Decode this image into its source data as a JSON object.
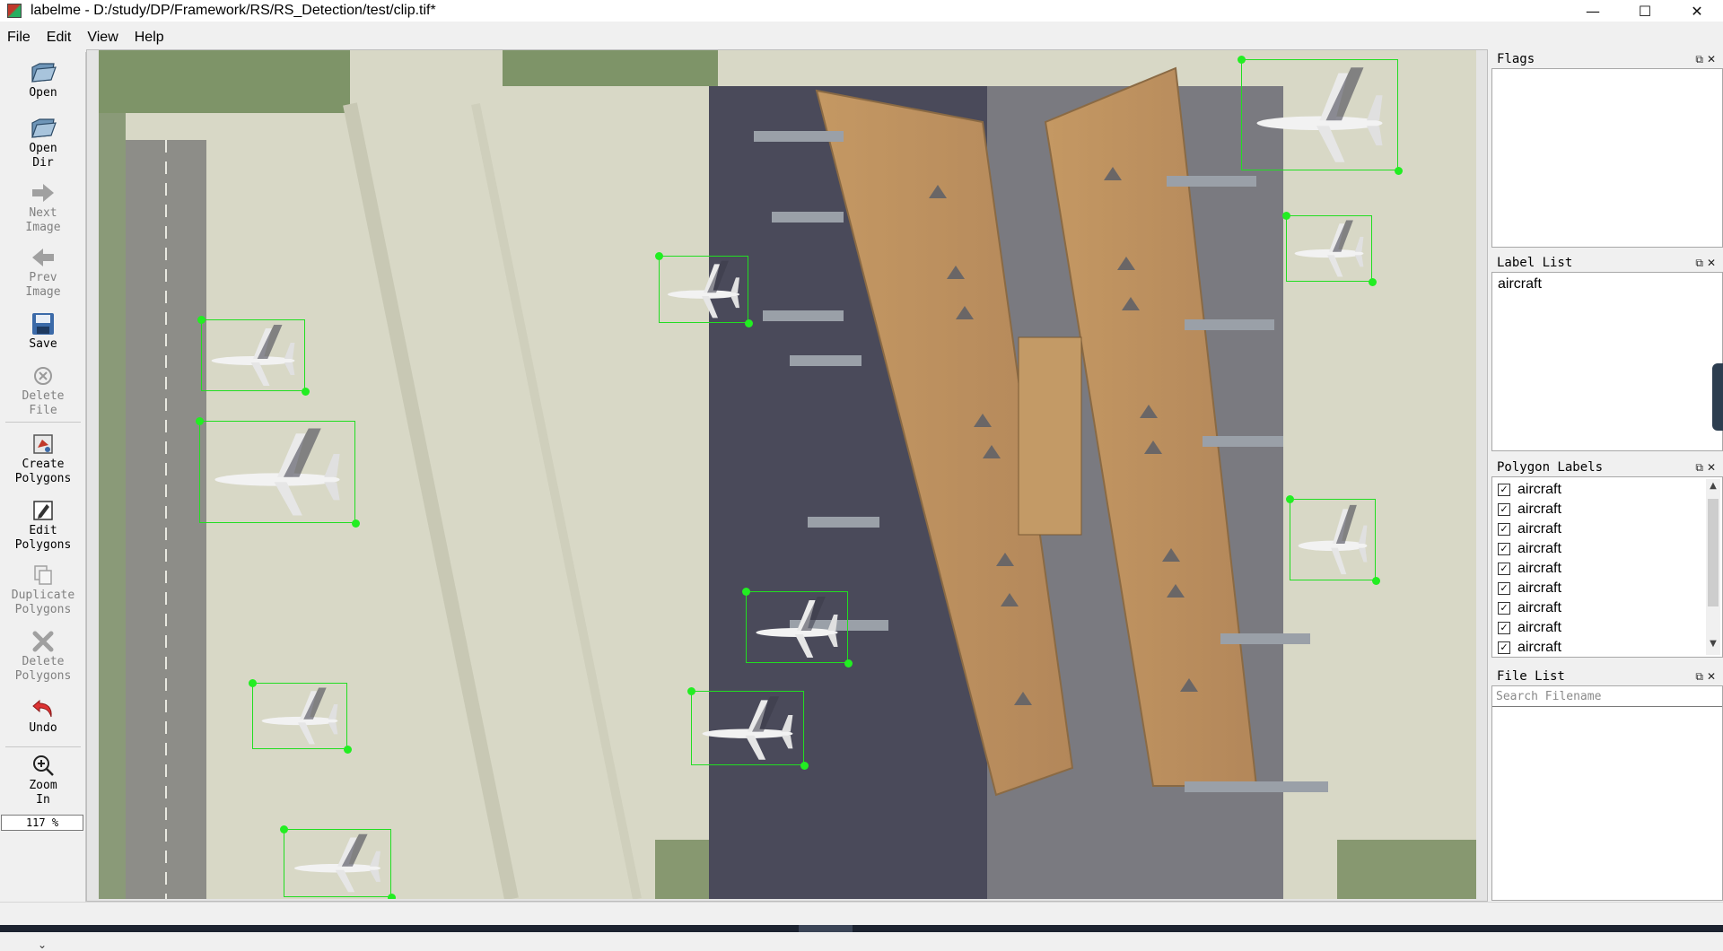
{
  "window": {
    "title": "labelme - D:/study/DP/Framework/RS/RS_Detection/test/clip.tif*",
    "minimize_icon": "minimize-icon",
    "maximize_icon": "maximize-icon",
    "close_icon": "close-icon"
  },
  "menu": [
    "File",
    "Edit",
    "View",
    "Help"
  ],
  "toolbar": {
    "open": {
      "label": "Open",
      "icon": "folder-open-icon"
    },
    "open_dir": {
      "label": "Open\nDir",
      "icon": "folder-open-icon"
    },
    "next_image": {
      "label": "Next\nImage",
      "icon": "arrow-right-icon"
    },
    "prev_image": {
      "label": "Prev\nImage",
      "icon": "arrow-left-icon"
    },
    "save": {
      "label": "Save",
      "icon": "floppy-disk-icon"
    },
    "delete_file": {
      "label": "Delete\nFile",
      "icon": "delete-circle-icon"
    },
    "create_polygons": {
      "label": "Create\nPolygons",
      "icon": "create-polygon-icon"
    },
    "edit_polygons": {
      "label": "Edit\nPolygons",
      "icon": "edit-icon"
    },
    "duplicate_polygons": {
      "label": "Duplicate\nPolygons",
      "icon": "copy-icon"
    },
    "delete_polygons": {
      "label": "Delete\nPolygons",
      "icon": "x-icon"
    },
    "undo": {
      "label": "Undo",
      "icon": "undo-icon"
    },
    "zoom_in": {
      "label": "Zoom\nIn",
      "icon": "zoom-in-icon"
    },
    "zoom_value": "117 %"
  },
  "docks": {
    "flags": {
      "title": "Flags"
    },
    "label_list": {
      "title": "Label List",
      "items": [
        "aircraft"
      ]
    },
    "polygon_labels": {
      "title": "Polygon Labels",
      "items": [
        {
          "label": "aircraft",
          "checked": true
        },
        {
          "label": "aircraft",
          "checked": true
        },
        {
          "label": "aircraft",
          "checked": true
        },
        {
          "label": "aircraft",
          "checked": true
        },
        {
          "label": "aircraft",
          "checked": true
        },
        {
          "label": "aircraft",
          "checked": true
        },
        {
          "label": "aircraft",
          "checked": true
        },
        {
          "label": "aircraft",
          "checked": true
        },
        {
          "label": "aircraft",
          "checked": true
        }
      ]
    },
    "file_list": {
      "title": "File List",
      "search_placeholder": "Search Filename"
    }
  },
  "canvas": {
    "image": "aerial view of airport terminal with parked aircraft",
    "annotation_color": "#22dd22",
    "annotations": [
      {
        "label": "aircraft"
      },
      {
        "label": "aircraft"
      },
      {
        "label": "aircraft"
      },
      {
        "label": "aircraft"
      },
      {
        "label": "aircraft"
      },
      {
        "label": "aircraft"
      },
      {
        "label": "aircraft"
      },
      {
        "label": "aircraft"
      },
      {
        "label": "aircraft"
      },
      {
        "label": "aircraft"
      },
      {
        "label": "aircraft"
      },
      {
        "label": "aircraft"
      }
    ]
  }
}
